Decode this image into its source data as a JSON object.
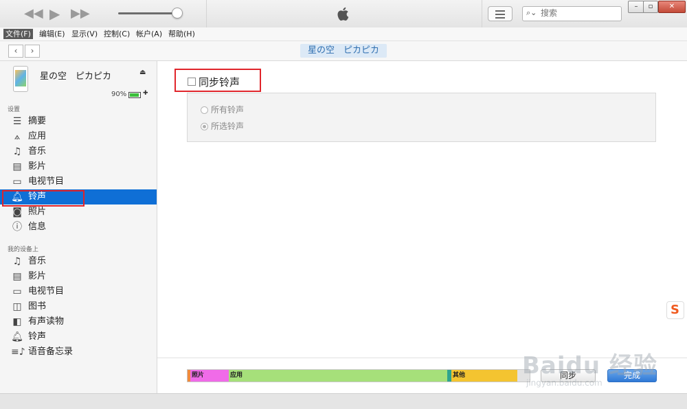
{
  "toolbar": {
    "rewind_icon": "rewind-icon",
    "play_icon": "play-icon",
    "forward_icon": "fast-forward-icon",
    "search_placeholder": "搜索",
    "window_min": "–",
    "window_restore": "▫",
    "window_close": "✕"
  },
  "menubar": {
    "items": [
      "文件(F)",
      "编辑(E)",
      "显示(V)",
      "控制(C)",
      "帐户(A)",
      "帮助(H)"
    ]
  },
  "nav": {
    "back": "‹",
    "forward": "›",
    "device_title": "星の空　ピカピカ"
  },
  "device": {
    "name": "星の空　ピカピカ",
    "battery_percent": "90%",
    "battery_level": 0.9
  },
  "sidebar": {
    "settings_title": "设置",
    "settings_items": [
      {
        "label": "摘要",
        "icon": "summary-icon"
      },
      {
        "label": "应用",
        "icon": "apps-icon"
      },
      {
        "label": "音乐",
        "icon": "music-icon"
      },
      {
        "label": "影片",
        "icon": "film-icon"
      },
      {
        "label": "电视节目",
        "icon": "tv-icon"
      },
      {
        "label": "铃声",
        "icon": "bell-icon",
        "selected": true
      },
      {
        "label": "照片",
        "icon": "camera-icon"
      },
      {
        "label": "信息",
        "icon": "info-icon"
      }
    ],
    "ondevice_title": "我的设备上",
    "ondevice_items": [
      {
        "label": "音乐",
        "icon": "music-icon"
      },
      {
        "label": "影片",
        "icon": "film-icon"
      },
      {
        "label": "电视节目",
        "icon": "tv-icon"
      },
      {
        "label": "图书",
        "icon": "book-icon"
      },
      {
        "label": "有声读物",
        "icon": "audiobook-icon"
      },
      {
        "label": "铃声",
        "icon": "bell-icon"
      },
      {
        "label": "语音备忘录",
        "icon": "voice-memo-icon"
      }
    ]
  },
  "main": {
    "sync_label": "同步铃声",
    "radio_all": "所有铃声",
    "radio_selected": "所选铃声"
  },
  "capacity": {
    "segments": [
      {
        "label": "照片",
        "color": "#f06be8"
      },
      {
        "label": "应用",
        "color": "#a6e07a"
      },
      {
        "label": "其他",
        "color": "#f4c430"
      }
    ],
    "sync_button": "同步",
    "done_button": "完成"
  },
  "overlay": {
    "ime_logo": "S",
    "watermark_main": "Baidu 经验",
    "watermark_sub": "jingyan.baidu.com"
  },
  "colors": {
    "selection": "#0f6fd6",
    "highlight_box": "#e0242a",
    "device_pill_text": "#2f6fb0"
  }
}
